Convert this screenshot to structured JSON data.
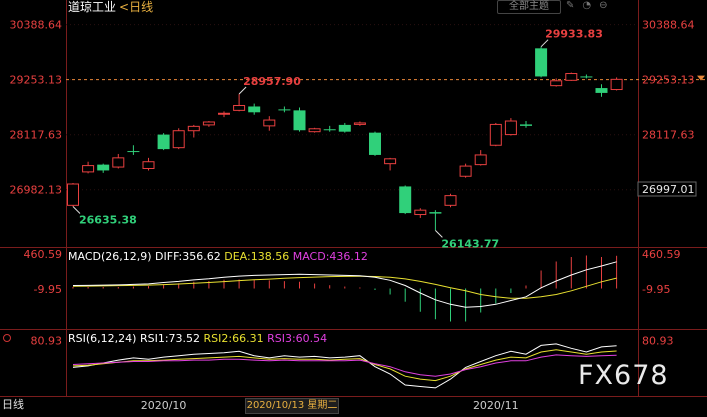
{
  "header": {
    "title": "道琼工业",
    "period_label": "<日线",
    "theme_button": "全部主题",
    "tool_icons": "✎◔⊖"
  },
  "footer": {
    "period_tab": "日线",
    "date_cursor": "2020/10/13 星期二",
    "watermark": "FX678"
  },
  "colors": {
    "up": "#e84040",
    "down": "#30d07a",
    "price_axis": "#e84040",
    "ma_white": "#ffffff",
    "ma_yellow": "#e8e030",
    "rsi_magenta": "#e040e0",
    "current_line": "#e8883a"
  },
  "chart_data": [
    {
      "type": "candlestick",
      "title": "道琼工业",
      "subtitle": "<日线",
      "y_ticks": [
        "30388.64",
        "29253.13",
        "28117.63",
        "26982.13"
      ],
      "y_tick_values": [
        30388.64,
        29253.13,
        28117.63,
        26982.13
      ],
      "ylim": [
        25800,
        30650
      ],
      "x_ticks": [
        "2020/10",
        "2020/11"
      ],
      "x_tick_indices": [
        6,
        28
      ],
      "current_price": 29253.13,
      "last_price_label": "26997.01",
      "last_price_value": 26997.01,
      "candles": [
        {
          "o": 26660,
          "h": 27120,
          "l": 26635.38,
          "c": 27100
        },
        {
          "o": 27350,
          "h": 27560,
          "l": 27320,
          "c": 27480
        },
        {
          "o": 27500,
          "h": 27520,
          "l": 27330,
          "c": 27380
        },
        {
          "o": 27450,
          "h": 27720,
          "l": 27420,
          "c": 27640
        },
        {
          "o": 27780,
          "h": 27900,
          "l": 27700,
          "c": 27760
        },
        {
          "o": 27420,
          "h": 27640,
          "l": 27380,
          "c": 27560
        },
        {
          "o": 28120,
          "h": 28150,
          "l": 27800,
          "c": 27820
        },
        {
          "o": 27850,
          "h": 28250,
          "l": 27820,
          "c": 28200
        },
        {
          "o": 28200,
          "h": 28320,
          "l": 28060,
          "c": 28290
        },
        {
          "o": 28320,
          "h": 28400,
          "l": 28280,
          "c": 28380
        },
        {
          "o": 28560,
          "h": 28600,
          "l": 28480,
          "c": 28560
        },
        {
          "o": 28620,
          "h": 28957.9,
          "l": 28600,
          "c": 28720
        },
        {
          "o": 28700,
          "h": 28760,
          "l": 28530,
          "c": 28580
        },
        {
          "o": 28300,
          "h": 28500,
          "l": 28200,
          "c": 28420
        },
        {
          "o": 28640,
          "h": 28700,
          "l": 28580,
          "c": 28630
        },
        {
          "o": 28620,
          "h": 28680,
          "l": 28180,
          "c": 28210
        },
        {
          "o": 28180,
          "h": 28260,
          "l": 28160,
          "c": 28240
        },
        {
          "o": 28230,
          "h": 28300,
          "l": 28180,
          "c": 28210
        },
        {
          "o": 28320,
          "h": 28360,
          "l": 28160,
          "c": 28180
        },
        {
          "o": 28330,
          "h": 28390,
          "l": 28300,
          "c": 28360
        },
        {
          "o": 28160,
          "h": 28180,
          "l": 27680,
          "c": 27700
        },
        {
          "o": 27520,
          "h": 27640,
          "l": 27380,
          "c": 27620
        },
        {
          "o": 27050,
          "h": 27070,
          "l": 26480,
          "c": 26500
        },
        {
          "o": 26470,
          "h": 26600,
          "l": 26400,
          "c": 26560
        },
        {
          "o": 26520,
          "h": 26560,
          "l": 26143.77,
          "c": 26490
        },
        {
          "o": 26660,
          "h": 26900,
          "l": 26620,
          "c": 26860
        },
        {
          "o": 27260,
          "h": 27520,
          "l": 27230,
          "c": 27470
        },
        {
          "o": 27500,
          "h": 27800,
          "l": 27480,
          "c": 27700
        },
        {
          "o": 27900,
          "h": 28360,
          "l": 27880,
          "c": 28330
        },
        {
          "o": 28120,
          "h": 28460,
          "l": 28100,
          "c": 28400
        },
        {
          "o": 28330,
          "h": 28400,
          "l": 28260,
          "c": 28300
        },
        {
          "o": 29900,
          "h": 29933.83,
          "l": 29300,
          "c": 29320
        },
        {
          "o": 29130,
          "h": 29280,
          "l": 29110,
          "c": 29230
        },
        {
          "o": 29240,
          "h": 29400,
          "l": 29230,
          "c": 29380
        },
        {
          "o": 29320,
          "h": 29360,
          "l": 29280,
          "c": 29300
        },
        {
          "o": 29080,
          "h": 29160,
          "l": 28900,
          "c": 28980
        },
        {
          "o": 29050,
          "h": 29300,
          "l": 29030,
          "c": 29260
        }
      ],
      "annotations": [
        {
          "text": "26635.38",
          "candle": 0,
          "value": 26635.38,
          "kind": "low"
        },
        {
          "text": "28957.90",
          "candle": 11,
          "value": 28957.9,
          "kind": "high"
        },
        {
          "text": "26143.77",
          "candle": 24,
          "value": 26143.77,
          "kind": "low"
        },
        {
          "text": "29933.83",
          "candle": 31,
          "value": 29933.83,
          "kind": "high"
        }
      ]
    },
    {
      "type": "macd",
      "legend": {
        "label": "MACD(26,12,9)",
        "diff": "DIFF:356.62",
        "dea": "DEA:138.56",
        "macd": "MACD:436.12"
      },
      "y_ticks": [
        "460.59",
        "-9.95"
      ],
      "y_tick_values": [
        460.59,
        -9.95
      ],
      "ylim": [
        -540,
        540
      ],
      "diff": [
        40,
        42,
        45,
        48,
        55,
        62,
        80,
        95,
        115,
        130,
        150,
        165,
        175,
        180,
        185,
        190,
        185,
        180,
        175,
        170,
        150,
        110,
        40,
        -60,
        -150,
        -210,
        -250,
        -240,
        -210,
        -160,
        -110,
        10,
        100,
        180,
        250,
        300,
        356.62
      ],
      "dea": [
        30,
        32,
        35,
        38,
        42,
        46,
        52,
        60,
        70,
        80,
        92,
        105,
        116,
        126,
        136,
        145,
        152,
        158,
        162,
        163,
        160,
        150,
        128,
        95,
        55,
        10,
        -30,
        -80,
        -110,
        -130,
        -130,
        -110,
        -80,
        -30,
        30,
        90,
        138.56
      ],
      "hist": [
        20,
        20,
        20,
        20,
        26,
        32,
        56,
        70,
        90,
        100,
        116,
        120,
        118,
        108,
        98,
        90,
        66,
        44,
        26,
        14,
        -20,
        -80,
        -176,
        -310,
        -410,
        -440,
        -440,
        -320,
        -200,
        -60,
        40,
        240,
        360,
        420,
        440,
        420,
        436.12
      ]
    },
    {
      "type": "line",
      "legend": {
        "label": "RSI(6,12,24)",
        "rsi1": "RSI1:73.52",
        "rsi2": "RSI2:66.31",
        "rsi3": "RSI3:60.54"
      },
      "y_ticks": [
        "80.93"
      ],
      "y_tick_values": [
        80.93
      ],
      "ylim": [
        5,
        95
      ],
      "series": [
        {
          "name": "RSI1",
          "values": [
            44,
            46,
            50,
            54,
            57,
            55,
            58,
            60,
            62,
            63,
            64,
            66,
            60,
            57,
            60,
            58,
            59,
            57,
            58,
            60,
            45,
            35,
            20,
            18,
            16,
            28,
            44,
            52,
            60,
            66,
            62,
            74,
            76,
            70,
            65,
            72,
            73.52
          ]
        },
        {
          "name": "RSI2",
          "values": [
            46,
            47,
            49,
            51,
            53,
            53,
            54,
            55,
            56,
            57,
            58,
            59,
            57,
            55,
            56,
            55,
            55,
            54,
            55,
            56,
            48,
            42,
            32,
            28,
            26,
            32,
            42,
            48,
            54,
            58,
            57,
            65,
            68,
            65,
            62,
            65,
            66.31
          ]
        },
        {
          "name": "RSI3",
          "values": [
            48,
            49,
            50,
            51,
            52,
            52,
            53,
            53,
            54,
            54,
            55,
            55,
            54,
            53,
            54,
            53,
            53,
            53,
            53,
            54,
            49,
            45,
            38,
            34,
            32,
            35,
            41,
            45,
            50,
            53,
            53,
            58,
            61,
            60,
            59,
            60,
            60.54
          ]
        }
      ]
    }
  ]
}
